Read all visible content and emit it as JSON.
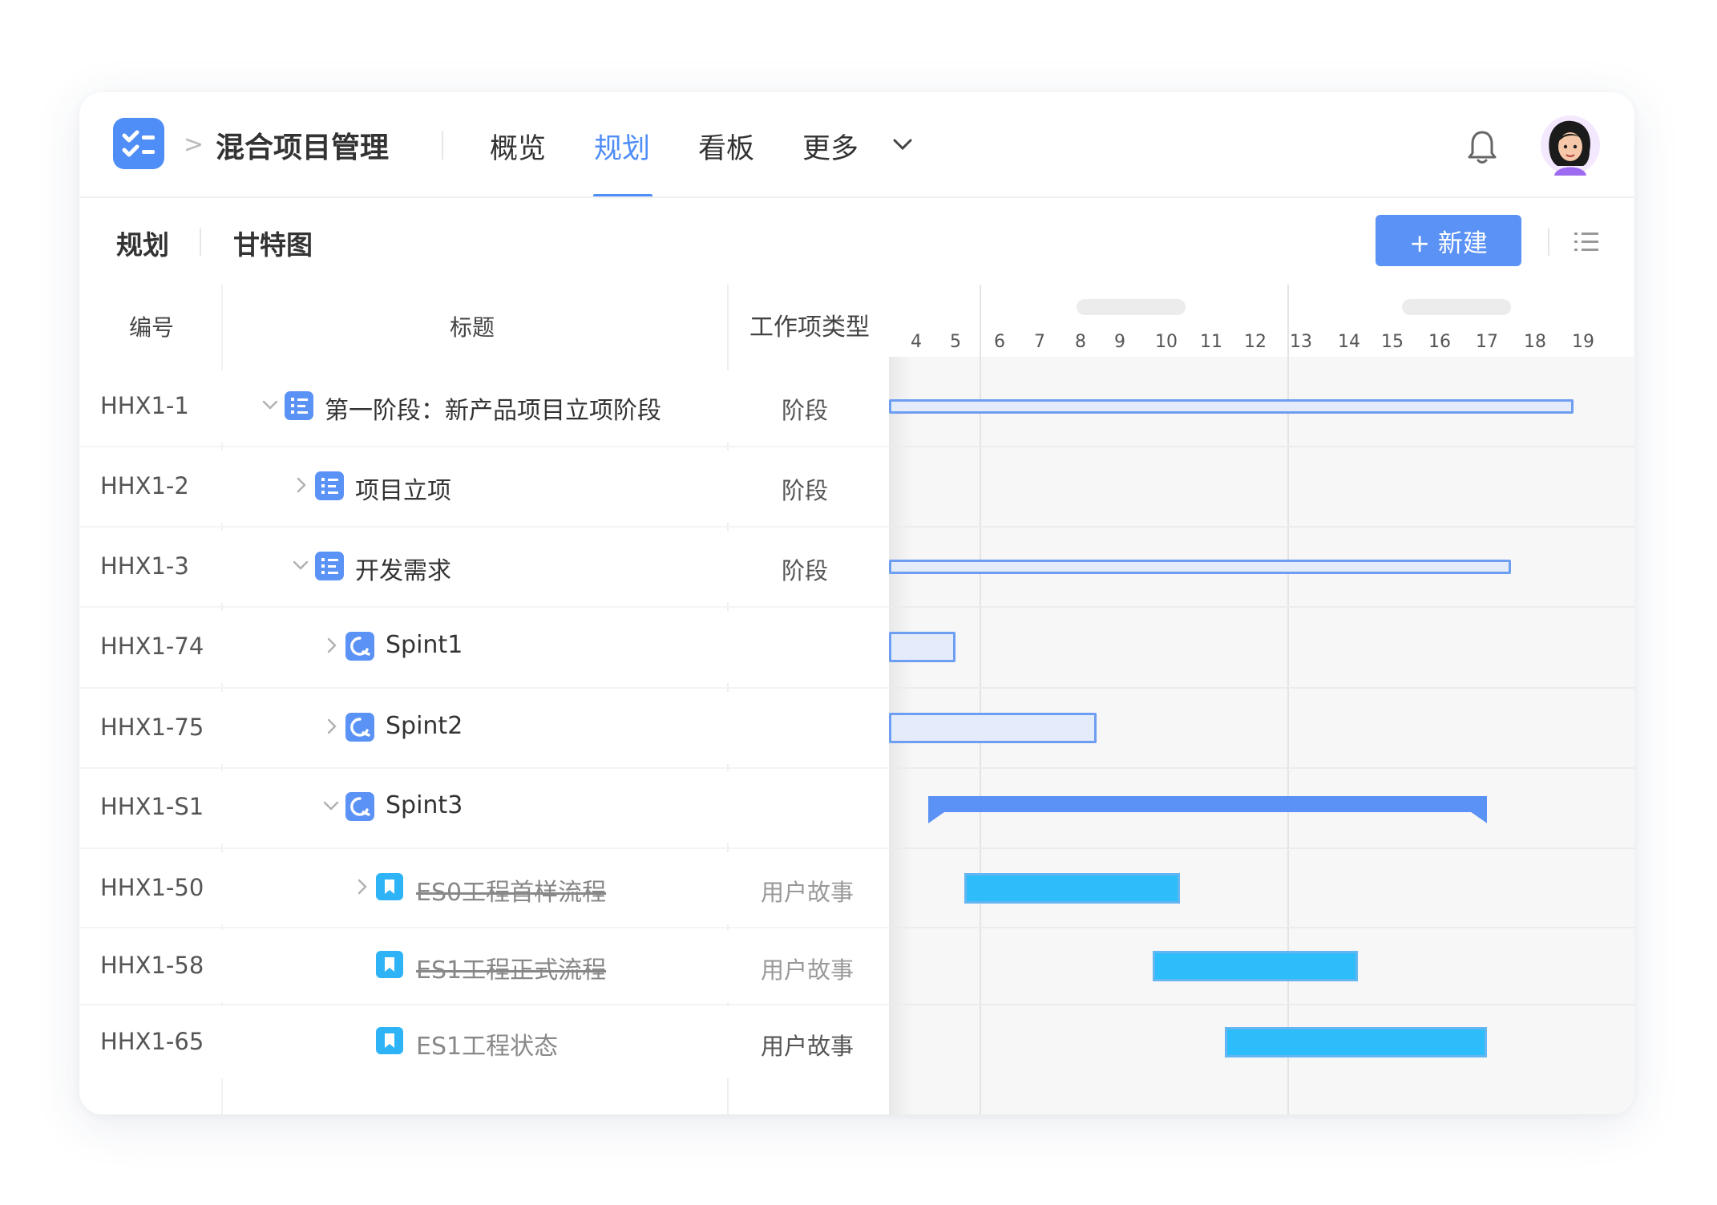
{
  "app": {
    "project_name": "混合项目管理",
    "breadcrumb_separator": ">",
    "nav_tabs": [
      {
        "label": "概览",
        "active": false
      },
      {
        "label": "规划",
        "active": true
      },
      {
        "label": "看板",
        "active": false
      },
      {
        "label": "更多",
        "active": false
      }
    ],
    "accent_color": "#4f8df7"
  },
  "subnav": {
    "tabs": [
      "规划",
      "甘特图"
    ],
    "new_button": "+ 新建"
  },
  "table": {
    "headers": {
      "id": "编号",
      "title": "标题",
      "type": "工作项类型"
    },
    "rows": [
      {
        "id": "HHX1-1",
        "title": "第一阶段：新产品项目立项阶段",
        "type": "阶段",
        "icon": "stage-icon",
        "expander": "expanded"
      },
      {
        "id": "HHX1-2",
        "title": "项目立项",
        "type": "阶段",
        "icon": "stage-icon",
        "expander": "collapsed"
      },
      {
        "id": "HHX1-3",
        "title": "开发需求",
        "type": "阶段",
        "icon": "stage-icon",
        "expander": "expanded"
      },
      {
        "id": "HHX1-74",
        "title": "Spint1",
        "type": "",
        "icon": "sprint-icon",
        "expander": "collapsed"
      },
      {
        "id": "HHX1-75",
        "title": "Spint2",
        "type": "",
        "icon": "sprint-icon",
        "expander": "collapsed"
      },
      {
        "id": "HHX1-S1",
        "title": "Spint3",
        "type": "",
        "icon": "sprint-icon",
        "expander": "expanded"
      },
      {
        "id": "HHX1-50",
        "title": "ES0工程首样流程",
        "type": "用户故事",
        "icon": "bookmark-icon",
        "expander": "collapsed",
        "done": true
      },
      {
        "id": "HHX1-58",
        "title": "ES1工程正式流程",
        "type": "用户故事",
        "icon": "bookmark-icon",
        "expander": "none",
        "done": true
      },
      {
        "id": "HHX1-65",
        "title": "ES1工程状态",
        "type": "用户故事",
        "icon": "bookmark-icon",
        "expander": "none",
        "done": false
      }
    ]
  },
  "gantt": {
    "days": [
      "4",
      "5",
      "6",
      "7",
      "8",
      "9",
      "10",
      "11",
      "12",
      "13",
      "14",
      "15",
      "16",
      "17",
      "18",
      "19"
    ],
    "bars": [
      {
        "row": "HHX1-1",
        "start": "3",
        "end": "18.8",
        "style": "outline"
      },
      {
        "row": "HHX1-3",
        "start": "3",
        "end": "17.5",
        "style": "outline"
      },
      {
        "row": "HHX1-74",
        "start": "3",
        "end": "5",
        "style": "outline"
      },
      {
        "row": "HHX1-75",
        "start": "3",
        "end": "8.4",
        "style": "outline"
      },
      {
        "row": "HHX1-S1",
        "start": "4.3",
        "end": "17",
        "style": "summary"
      },
      {
        "row": "HHX1-50",
        "start": "5.2",
        "end": "10.3",
        "style": "task"
      },
      {
        "row": "HHX1-58",
        "start": "9.7",
        "end": "14.2",
        "style": "task"
      },
      {
        "row": "HHX1-65",
        "start": "11.3",
        "end": "17",
        "style": "task"
      }
    ]
  }
}
